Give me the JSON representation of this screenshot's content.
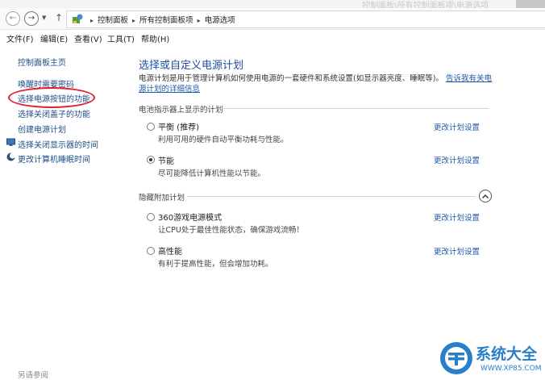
{
  "titlebar": {
    "ghost_text": "控制面板\\所有控制面板项\\电源选项"
  },
  "address": {
    "back": "←",
    "forward": "→",
    "dropdown": "▼",
    "up": "↑",
    "crumbs": [
      "控制面板",
      "所有控制面板项",
      "电源选项"
    ],
    "sep": "▸"
  },
  "menu": [
    "文件(F)",
    "编辑(E)",
    "查看(V)",
    "工具(T)",
    "帮助(H)"
  ],
  "sidebar": {
    "items": [
      "控制面板主页",
      "唤醒时需要密码",
      "选择电源按钮的功能",
      "选择关闭盖子的功能",
      "创建电源计划",
      "选择关闭显示器的时间",
      "更改计算机睡眠时间"
    ],
    "see_also": "另请参阅"
  },
  "main": {
    "title": "选择或自定义电源计划",
    "desc_line1": "电源计划是用于管理计算机如何使用电源的一套硬件和系统设置(如显示器亮度、睡眠等)。",
    "desc_link": "告诉我有关电源计划的详细信息",
    "section1": "电池指示器上显示的计划",
    "section2": "隐藏附加计划",
    "change_label": "更改计划设置",
    "plans": [
      {
        "name": "平衡 (推荐)",
        "desc": "利用可用的硬件自动平衡功耗与性能。"
      },
      {
        "name": "节能",
        "desc": "尽可能降低计算机性能以节能。"
      },
      {
        "name": "360游戏电源模式",
        "desc": "让CPU处于最佳性能状态，确保游戏流畅！"
      },
      {
        "name": "高性能",
        "desc": "有利于提高性能，但会增加功耗。"
      }
    ]
  },
  "watermark": {
    "name": "系统大全",
    "url": "WWW.XP85.COM"
  }
}
